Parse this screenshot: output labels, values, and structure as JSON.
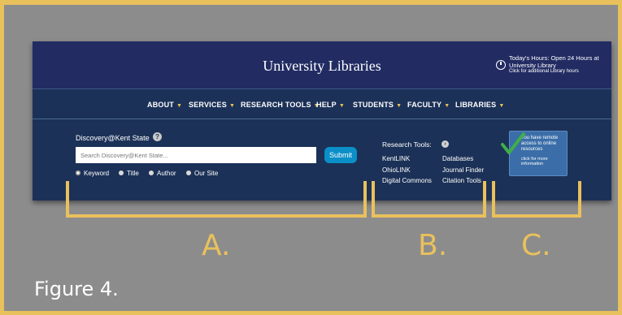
{
  "header": {
    "site_title": "University Libraries",
    "hours": {
      "line1": "Today's Hours: Open 24 Hours at",
      "line2": "University Library",
      "line3": "Click for additional Library hours"
    }
  },
  "nav": {
    "items": [
      {
        "label": "ABOUT"
      },
      {
        "label": "SERVICES"
      },
      {
        "label": "RESEARCH TOOLS"
      },
      {
        "label": "HELP"
      },
      {
        "label": "STUDENTS"
      },
      {
        "label": "FACULTY"
      },
      {
        "label": "LIBRARIES"
      }
    ]
  },
  "search": {
    "label": "Discovery@Kent State",
    "help_icon": "?",
    "placeholder": "Search Discovery@Kent State...",
    "submit_label": "Submit",
    "options": [
      {
        "label": "Keyword",
        "selected": true
      },
      {
        "label": "Title",
        "selected": false
      },
      {
        "label": "Author",
        "selected": false
      },
      {
        "label": "Our Site",
        "selected": false
      }
    ]
  },
  "research_tools": {
    "label": "Research Tools:",
    "arrow_icon": "›",
    "links": [
      "KentLINK",
      "Databases",
      "OhioLINK",
      "Journal Finder",
      "Digital Commons",
      "Citation Tools"
    ]
  },
  "remote_access": {
    "text": "You have remote access to online resources",
    "more": "click for more information"
  },
  "annotations": {
    "letters": [
      "A.",
      "B.",
      "C."
    ],
    "caption": "Figure 4."
  },
  "colors": {
    "frame_border": "#e9c15c",
    "background": "#8c8c8c",
    "header": "#222c63",
    "panel": "#1c3157",
    "submit": "#0a8fc8",
    "remote_box": "#3b6ea8",
    "check": "#3fae49",
    "bracket": "#e9c15c"
  }
}
